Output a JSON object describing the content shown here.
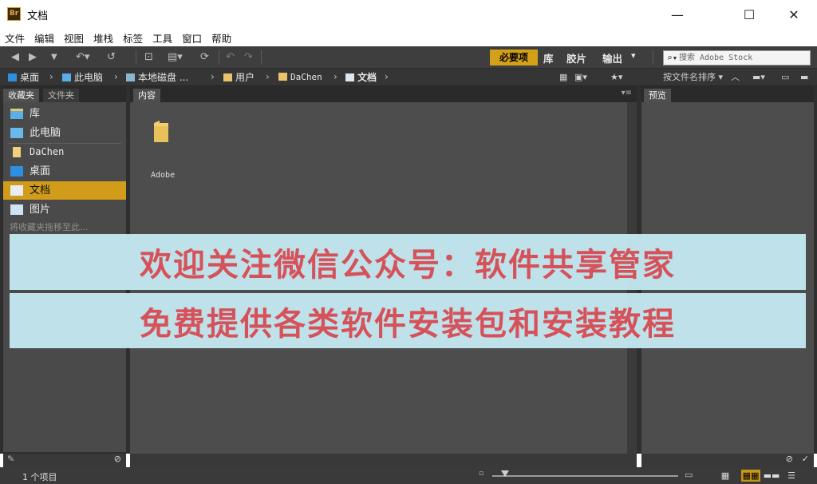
{
  "window": {
    "app_icon_text": "Br",
    "title": "文档",
    "minimize": "—",
    "maximize": "☐",
    "close": "✕"
  },
  "menu": [
    "文件",
    "编辑",
    "视图",
    "堆栈",
    "标签",
    "工具",
    "窗口",
    "帮助"
  ],
  "toolbar": {
    "workspaces": {
      "active": "必要项",
      "others": [
        "库",
        "胶片",
        "输出"
      ]
    },
    "workspace_dropdown": "▾",
    "search_placeholder": "搜索 Adobe Stock"
  },
  "path": {
    "crumbs": [
      "桌面",
      "此电脑",
      "本地磁盘 ...",
      "用户",
      "DaChen",
      "文档"
    ],
    "sort_label": "按文件名排序"
  },
  "panels": {
    "favorites_tab": "收藏夹",
    "folders_tab": "文件夹",
    "content_tab": "内容",
    "preview_tab": "预览",
    "favorites": [
      "库",
      "此电脑",
      "DaChen",
      "桌面",
      "文档",
      "图片"
    ],
    "favorites_selected_index": 4,
    "favorites_hint": "将收藏夹拖移至此..."
  },
  "content": {
    "items": [
      {
        "name": "Adobe",
        "type": "folder"
      }
    ]
  },
  "status": {
    "item_count": "1 个项目"
  },
  "overlay": {
    "line1": "欢迎关注微信公众号：软件共享管家",
    "line2": "免费提供各类软件安装包和安装教程"
  },
  "colors": {
    "accent": "#d4a017",
    "panel": "#4d4d4d",
    "banner_bg": "#c4e8f0",
    "banner_text": "#d6525a"
  }
}
